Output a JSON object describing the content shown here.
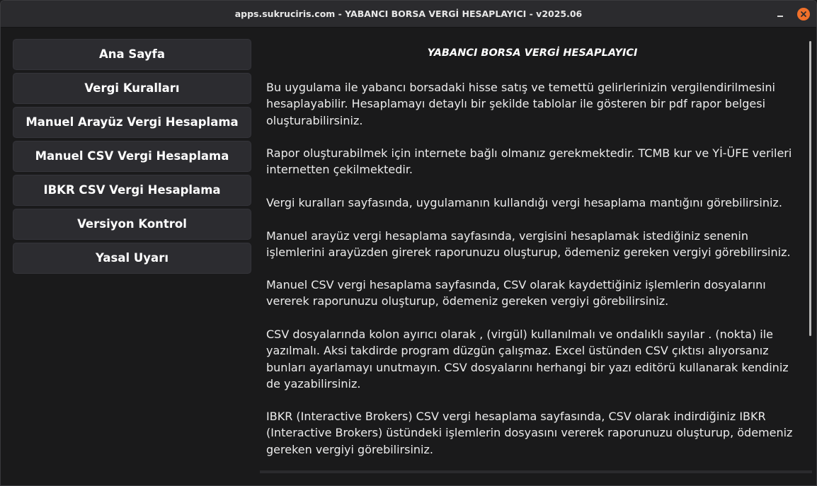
{
  "window": {
    "title": "apps.sukruciris.com - YABANCI BORSA VERGİ HESAPLAYICI - v2025.06"
  },
  "sidebar": {
    "items": [
      {
        "label": "Ana Sayfa"
      },
      {
        "label": "Vergi Kuralları"
      },
      {
        "label": "Manuel Arayüz Vergi Hesaplama"
      },
      {
        "label": "Manuel CSV Vergi Hesaplama"
      },
      {
        "label": "IBKR CSV Vergi Hesaplama"
      },
      {
        "label": "Versiyon Kontrol"
      },
      {
        "label": "Yasal Uyarı"
      }
    ]
  },
  "main": {
    "title": "YABANCI BORSA VERGİ HESAPLAYICI",
    "paragraphs": [
      "Bu uygulama ile yabancı borsadaki hisse satış ve temettü gelirlerinizin vergilendirilmesini hesaplayabilir. Hesaplamayı detaylı bir şekilde tablolar ile gösteren bir pdf rapor belgesi oluşturabilirsiniz.",
      "Rapor oluşturabilmek için internete bağlı olmanız gerekmektedir. TCMB kur ve Yİ-ÜFE verileri internetten çekilmektedir.",
      "Vergi kuralları sayfasında, uygulamanın kullandığı vergi hesaplama mantığını görebilirsiniz.",
      "Manuel arayüz vergi hesaplama sayfasında, vergisini hesaplamak istediğiniz senenin işlemlerini arayüzden girerek raporunuzu oluşturup, ödemeniz gereken vergiyi görebilirsiniz.",
      "Manuel CSV vergi hesaplama sayfasında, CSV olarak kaydettiğiniz işlemlerin dosyalarını vererek raporunuzu oluşturup, ödemeniz gereken vergiyi görebilirsiniz.",
      "CSV dosyalarında kolon ayırıcı olarak , (virgül) kullanılmalı ve ondalıklı sayılar . (nokta) ile yazılmalı. Aksi takdirde program düzgün çalışmaz. Excel üstünden CSV çıktısı alıyorsanız bunları ayarlamayı unutmayın. CSV dosyalarını herhangi bir yazı editörü kullanarak kendiniz de yazabilirsiniz.",
      "IBKR (Interactive Brokers) CSV vergi hesaplama sayfasında, CSV olarak indirdiğiniz IBKR (Interactive Brokers) üstündeki işlemlerin dosyasını vererek raporunuzu oluşturup, ödemeniz gereken vergiyi görebilirsiniz."
    ]
  },
  "colors": {
    "close_button": "#f0702a",
    "nav_button_bg": "#2c2c30",
    "background": "#1a1a1b"
  },
  "icons": {
    "minimize": "minimize-icon",
    "close": "close-icon"
  }
}
